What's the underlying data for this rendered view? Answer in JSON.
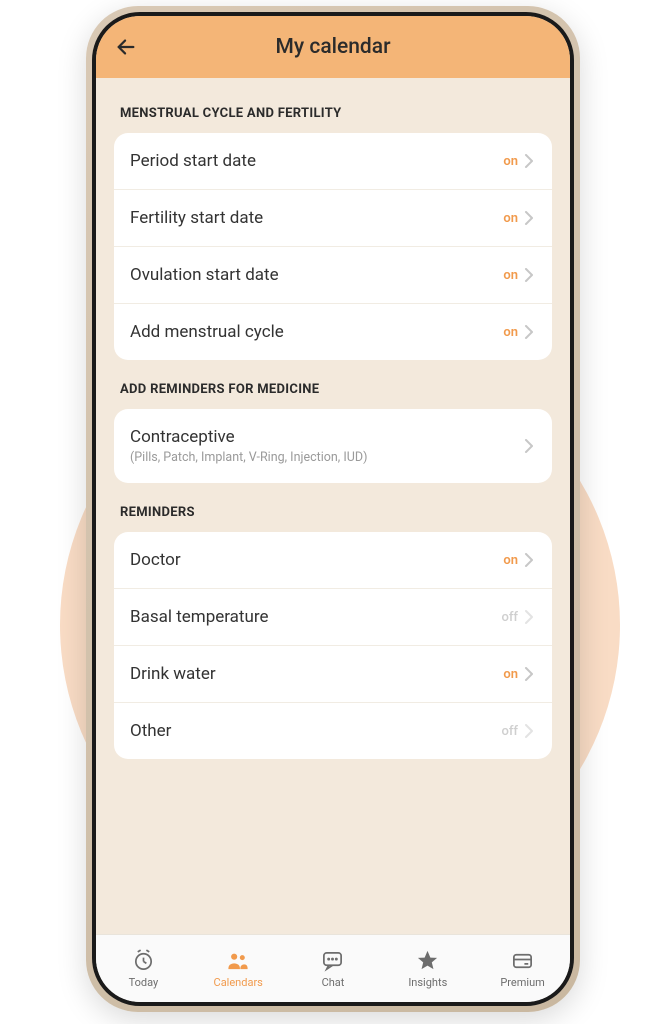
{
  "header": {
    "title": "My calendar"
  },
  "sections": {
    "cycle": {
      "title": "MENSTRUAL CYCLE AND FERTILITY",
      "items": [
        {
          "label": "Period start date",
          "state": "on"
        },
        {
          "label": "Fertility start date",
          "state": "on"
        },
        {
          "label": "Ovulation start date",
          "state": "on"
        },
        {
          "label": "Add menstrual cycle",
          "state": "on"
        }
      ]
    },
    "medicine": {
      "title": "ADD REMINDERS FOR MEDICINE",
      "items": [
        {
          "label": "Contraceptive",
          "sub": "(Pills, Patch, Implant, V-Ring, Injection, IUD)"
        }
      ]
    },
    "reminders": {
      "title": "REMINDERS",
      "items": [
        {
          "label": "Doctor",
          "state": "on"
        },
        {
          "label": "Basal temperature",
          "state": "off"
        },
        {
          "label": "Drink water",
          "state": "on"
        },
        {
          "label": "Other",
          "state": "off"
        }
      ]
    }
  },
  "nav": {
    "items": [
      {
        "label": "Today",
        "icon": "clock-icon"
      },
      {
        "label": "Calendars",
        "icon": "people-icon",
        "active": true
      },
      {
        "label": "Chat",
        "icon": "chat-icon"
      },
      {
        "label": "Insights",
        "icon": "star-icon"
      },
      {
        "label": "Premium",
        "icon": "card-icon"
      }
    ]
  }
}
